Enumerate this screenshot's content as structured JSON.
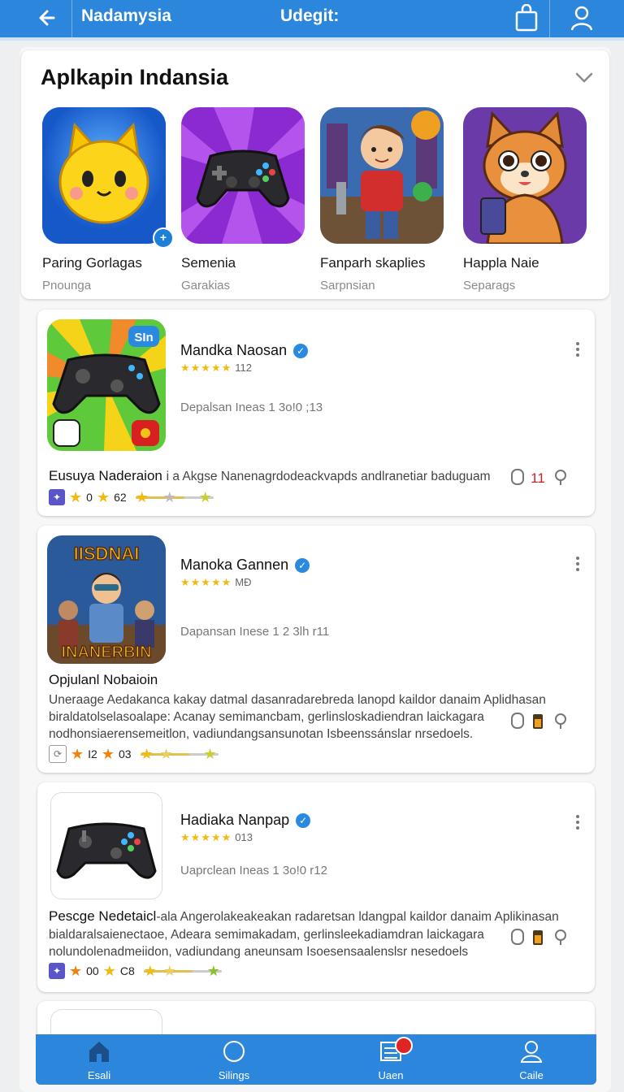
{
  "header": {
    "brand": "Nadamysia",
    "center_title": "Udegit:"
  },
  "featured": {
    "title": "Aplkapin Indansia",
    "apps": [
      {
        "name": "Paring Gorlagas",
        "sub": "Pnounga",
        "icon": "yellow-cat-icon",
        "bg": "#1f78e0"
      },
      {
        "name": "Semenia",
        "sub": "Garakias",
        "icon": "gamepad-icon",
        "bg": "#8a2ad0"
      },
      {
        "name": "Fanparh skaplies",
        "sub": "Sarpnsian",
        "icon": "game-character-icon",
        "bg": "#3a6bb0"
      },
      {
        "name": "Happla Naie",
        "sub": "Separags",
        "icon": "fox-character-icon",
        "bg": "#6a3aa8"
      }
    ]
  },
  "cards": [
    {
      "name": "Mandka Naosan",
      "rating": "112",
      "meta": "Depalsan Ineas 1 3o!0 ;13",
      "badge_text": "SIn",
      "heading": "Eusuya Naderaion",
      "desc_lines": [
        "i a Akgse Nanenagrdodeackvapds andlranetiar baduguam"
      ],
      "action_count": "11",
      "stat1": "0",
      "stat2": "62"
    },
    {
      "name": "Manoka Gannen",
      "rating": "MÐ",
      "meta": "Dapansan Inese 1 2 3lh r11",
      "poster_top": "IISDNAI",
      "poster_bottom": "INANERBIN",
      "heading": "Opjulanl Nobaioin",
      "desc_lines": [
        "Uneraage Aedakanca kakay datmal dasanradarebreda lanopd kaildor danaim Aplidhasan",
        "biraldatolselasoalape: Acanay semimancbam, gerlinsloskadiendran laickagara",
        "nodhonsiaerensemeitlon, vadiundangsansunotan Isbeenssánslar nrsedoels."
      ],
      "stat1": "I2",
      "stat2": "03"
    },
    {
      "name": "Hadiaka Nanpap",
      "rating": "013",
      "meta": "Uaprclean Ineas 1 3o!0 r12",
      "heading": "Pescge Nedetaicl",
      "desc_lines": [
        "-ala Angerolakeakeakan radaretsan ldangpal kaildor danaim Aplikinasan",
        "bialdaralsaienectaoe, Adeara semimakadam, gerlinsleekadiamdran laickagara",
        "nolundolenadmeiidon, vadiundang aneunsam Isoesensaalenslsr nesedoels"
      ],
      "stat1": "00",
      "stat2": "C8"
    }
  ],
  "bottom_nav": [
    {
      "label": "Esali",
      "icon": "home-icon"
    },
    {
      "label": "Silings",
      "icon": "circle-icon"
    },
    {
      "label": "Uaen",
      "icon": "list-icon"
    },
    {
      "label": "Caile",
      "icon": "profile-icon"
    }
  ],
  "colors": {
    "primary": "#2b86dc",
    "verified": "#2a8ae0",
    "star": "#f2b90f",
    "alert": "#e02424"
  }
}
